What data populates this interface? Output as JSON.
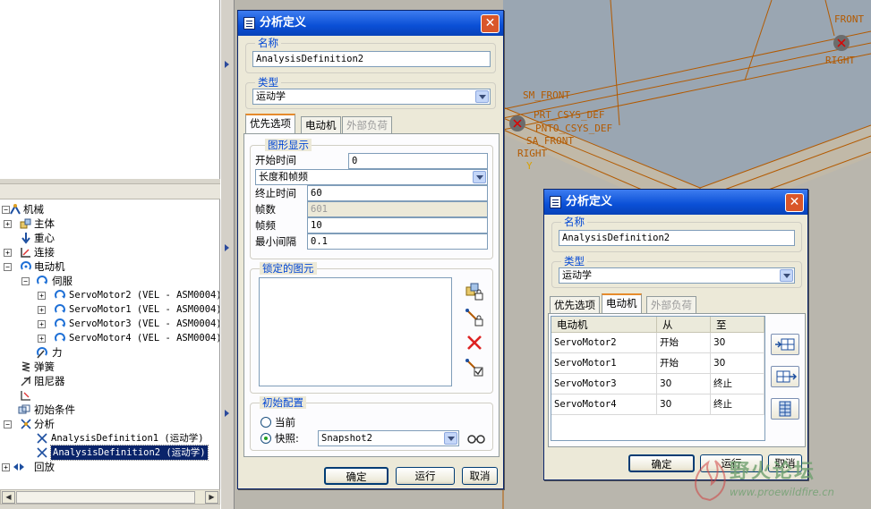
{
  "tree": {
    "items": [
      {
        "label": "机械",
        "level": 0,
        "expander": "−"
      },
      {
        "label": "主体",
        "level": 1,
        "expander": "+"
      },
      {
        "label": "重心",
        "level": 1,
        "expander": ""
      },
      {
        "label": "连接",
        "level": 1,
        "expander": "+"
      },
      {
        "label": "电动机",
        "level": 1,
        "expander": "−"
      },
      {
        "label": "伺服",
        "level": 2,
        "expander": "−"
      },
      {
        "label": "ServoMotor2 (VEL - ASM0004)",
        "level": 3,
        "expander": "+"
      },
      {
        "label": "ServoMotor1 (VEL - ASM0004)",
        "level": 3,
        "expander": "+"
      },
      {
        "label": "ServoMotor3 (VEL - ASM0004)",
        "level": 3,
        "expander": "+"
      },
      {
        "label": "ServoMotor4 (VEL - ASM0004)",
        "level": 3,
        "expander": "+"
      },
      {
        "label": "力",
        "level": 2,
        "expander": ""
      },
      {
        "label": "弹簧",
        "level": 1,
        "expander": ""
      },
      {
        "label": "阻尼器",
        "level": 1,
        "expander": ""
      },
      {
        "label": "",
        "level": 1,
        "expander": ""
      },
      {
        "label": "初始条件",
        "level": 1,
        "expander": ""
      },
      {
        "label": "分析",
        "level": 1,
        "expander": "−"
      },
      {
        "label": "AnalysisDefinition1 (运动学)",
        "level": 2,
        "expander": ""
      },
      {
        "label": "AnalysisDefinition2 (运动学)",
        "level": 2,
        "expander": "",
        "selected": true
      },
      {
        "label": "回放",
        "level": 0,
        "expander": "+"
      }
    ]
  },
  "viewport": {
    "labels": [
      "FRONT",
      "SM_FRONT",
      "PRT_CSYS_DEF",
      "PNTO_CSYS_DEF",
      "SA_FRONT",
      "RIGHT",
      "Y"
    ]
  },
  "dialog1": {
    "title": "分析定义",
    "name_group": "名称",
    "name_value": "AnalysisDefinition2",
    "type_group": "类型",
    "type_value": "运动学",
    "tabs": [
      "优先选项",
      "电动机",
      "外部负荷"
    ],
    "graphics_group": "图形显示",
    "start_time_label": "开始时间",
    "start_time_value": "0",
    "mode_value": "长度和帧频",
    "end_time_label": "终止时间",
    "end_time_value": "60",
    "frames_label": "帧数",
    "frames_value": "601",
    "frame_rate_label": "帧频",
    "frame_rate_value": "10",
    "min_interval_label": "最小间隔",
    "min_interval_value": "0.1",
    "locked_group": "锁定的图元",
    "init_group": "初始配置",
    "current_label": "当前",
    "snapshot_label": "快照:",
    "snapshot_value": "Snapshot2",
    "ok": "确定",
    "run": "运行",
    "cancel": "取消"
  },
  "dialog2": {
    "title": "分析定义",
    "name_group": "名称",
    "name_value": "AnalysisDefinition2",
    "type_group": "类型",
    "type_value": "运动学",
    "tabs": [
      "优先选项",
      "电动机",
      "外部负荷"
    ],
    "columns": [
      "电动机",
      "从",
      "至"
    ],
    "rows": [
      [
        "ServoMotor2",
        "开始",
        "30"
      ],
      [
        "ServoMotor1",
        "开始",
        "30"
      ],
      [
        "ServoMotor3",
        "30",
        "终止"
      ],
      [
        "ServoMotor4",
        "30",
        "终止"
      ]
    ],
    "ok": "确定",
    "run": "运行",
    "cancel": "取消"
  },
  "watermark": {
    "text": "野火论坛",
    "url": "www.proewildfire.cn"
  },
  "colors": {
    "titlebar": "#0a4fd6",
    "viewport_bg": "#b9b6ad",
    "datum_orange": "#b35a00",
    "selection": "#0a246a"
  }
}
